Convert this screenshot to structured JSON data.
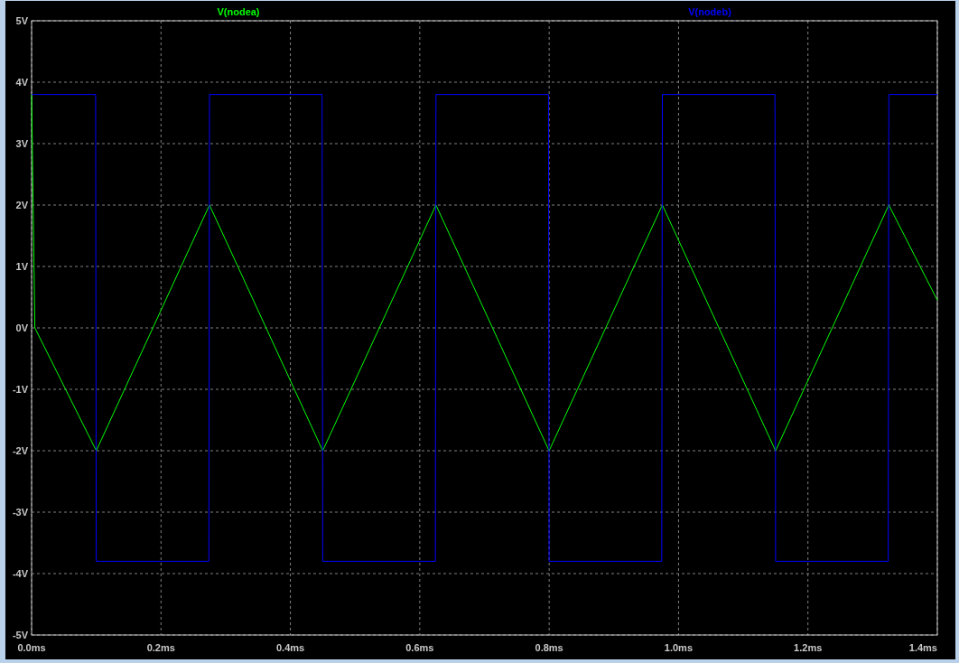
{
  "plot": {
    "chart_data": {
      "type": "line",
      "grid": true,
      "x": [
        0,
        0.005,
        0.099,
        0.1,
        0.274,
        0.275,
        0.449,
        0.45,
        0.624,
        0.625,
        0.799,
        0.8,
        0.974,
        0.975,
        1.149,
        1.15,
        1.324,
        1.325,
        1.4
      ],
      "series": [
        {
          "name": "V(nodea)",
          "color": "#00ff00",
          "values": [
            3.8,
            0,
            -1.98,
            -2,
            1.98,
            2,
            -1.98,
            -2,
            1.98,
            2,
            -1.98,
            -2,
            1.98,
            2,
            -1.98,
            -2,
            1.98,
            2,
            0.45
          ]
        },
        {
          "name": "V(nodeb)",
          "color": "#0000ff",
          "values": [
            3.8,
            3.8,
            3.8,
            -3.8,
            -3.8,
            3.8,
            3.8,
            -3.8,
            -3.8,
            3.8,
            3.8,
            -3.8,
            -3.8,
            3.8,
            3.8,
            -3.8,
            -3.8,
            3.8,
            3.8
          ]
        }
      ],
      "xlim": [
        0,
        1.4
      ],
      "ylim": [
        -5,
        5
      ],
      "xticks": [
        {
          "value": 0,
          "label": "0.0ms"
        },
        {
          "value": 0.2,
          "label": "0.2ms"
        },
        {
          "value": 0.4,
          "label": "0.4ms"
        },
        {
          "value": 0.6,
          "label": "0.6ms"
        },
        {
          "value": 0.8,
          "label": "0.8ms"
        },
        {
          "value": 1.0,
          "label": "1.0ms"
        },
        {
          "value": 1.2,
          "label": "1.2ms"
        },
        {
          "value": 1.4,
          "label": "1.4ms"
        }
      ],
      "yticks": [
        {
          "value": 5,
          "label": "5V"
        },
        {
          "value": 4,
          "label": "4V"
        },
        {
          "value": 3,
          "label": "3V"
        },
        {
          "value": 2,
          "label": "2V"
        },
        {
          "value": 1,
          "label": "1V"
        },
        {
          "value": 0,
          "label": "0V"
        },
        {
          "value": -1,
          "label": "-1V"
        },
        {
          "value": -2,
          "label": "-2V"
        },
        {
          "value": -3,
          "label": "-3V"
        },
        {
          "value": -4,
          "label": "-4V"
        },
        {
          "value": -5,
          "label": "-5V"
        }
      ]
    }
  }
}
